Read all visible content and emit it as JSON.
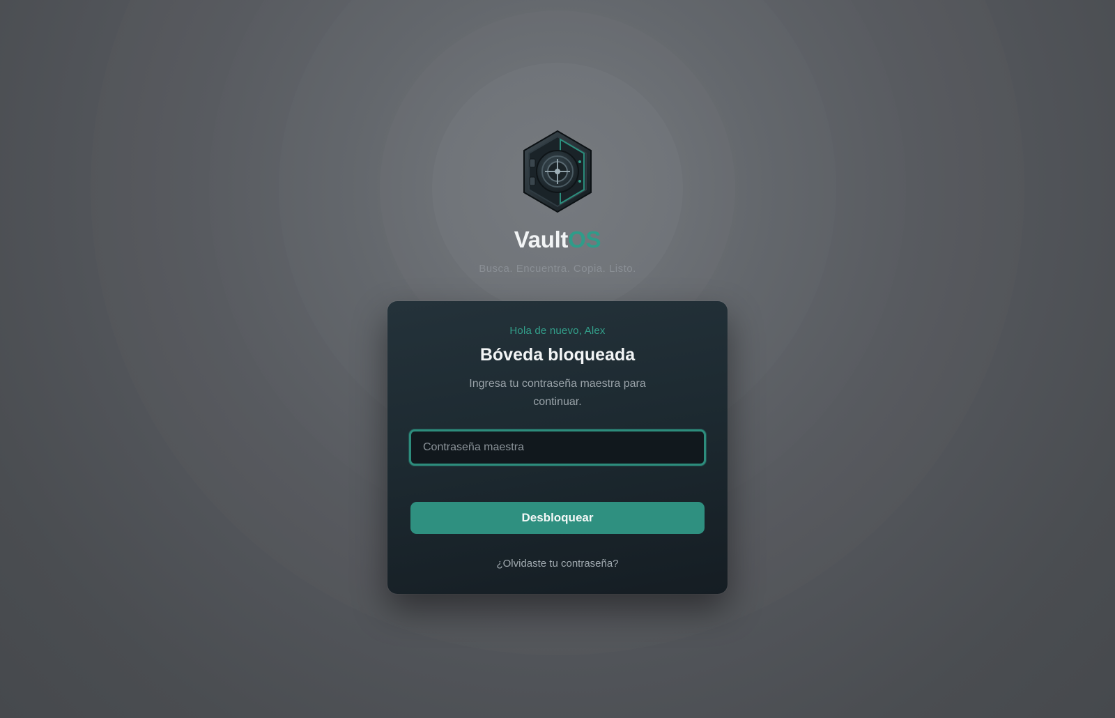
{
  "brand": {
    "name_main": "Vault",
    "name_accent": "OS",
    "tagline": "Busca. Encuentra. Copia. Listo.",
    "logo_icon": "vault-safe-icon",
    "accent_color": "#2f9c89"
  },
  "login_card": {
    "greeting": "Hola de nuevo, Alex",
    "title": "Bóveda bloqueada",
    "description": "Ingresa tu contraseña maestra para continuar.",
    "password_field": {
      "placeholder": "Contraseña maestra",
      "value": ""
    },
    "unlock_label": "Desbloquear",
    "forgot_label": "¿Olvidaste tu contraseña?"
  },
  "colors": {
    "accent": "#2f9c89",
    "button": "#2f9080",
    "card_background": "#1d2a31"
  }
}
